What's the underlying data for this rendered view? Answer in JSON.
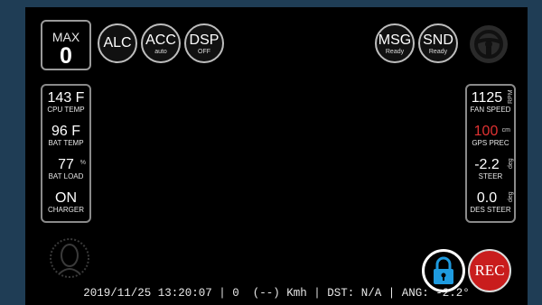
{
  "max": {
    "label": "MAX",
    "value": "0"
  },
  "top_buttons": [
    {
      "label": "ALC",
      "sub": ""
    },
    {
      "label": "ACC",
      "sub": "auto"
    },
    {
      "label": "DSP",
      "sub": "OFF"
    },
    {
      "label": "MSG",
      "sub": "Ready"
    },
    {
      "label": "SND",
      "sub": "Ready"
    }
  ],
  "left_panel": [
    {
      "value": "143 F",
      "label": "CPU TEMP",
      "unit": ""
    },
    {
      "value": "96 F",
      "label": "BAT TEMP",
      "unit": ""
    },
    {
      "value": "77",
      "label": "BAT LOAD",
      "unit": "%"
    },
    {
      "value": "ON",
      "label": "CHARGER",
      "unit": ""
    }
  ],
  "right_panel": [
    {
      "value": "1125",
      "label": "FAN SPEED",
      "unit": "RPM",
      "color": "#ffffff"
    },
    {
      "value": "100",
      "label": "GPS PREC",
      "unit": "cm",
      "color": "#e03232"
    },
    {
      "value": "-2.2",
      "label": "STEER",
      "unit": "deg",
      "color": "#ffffff"
    },
    {
      "value": "0.0",
      "label": "DES STEER",
      "unit": "deg",
      "color": "#ffffff"
    }
  ],
  "status_line": "2019/11/25 13:20:07 | 0  (--) Kmh | DST: N/A | ANG: -2.2°",
  "rec_label": "REC",
  "icons": {
    "steering": "steering-wheel-icon",
    "driver": "driver-monitor-icon",
    "lock": "lock-icon"
  },
  "colors": {
    "frame": "#1f3d55",
    "screen": "#000000",
    "rec": "#c91d1d",
    "lock": "#1e9be0",
    "gps_prec": "#e03232"
  }
}
